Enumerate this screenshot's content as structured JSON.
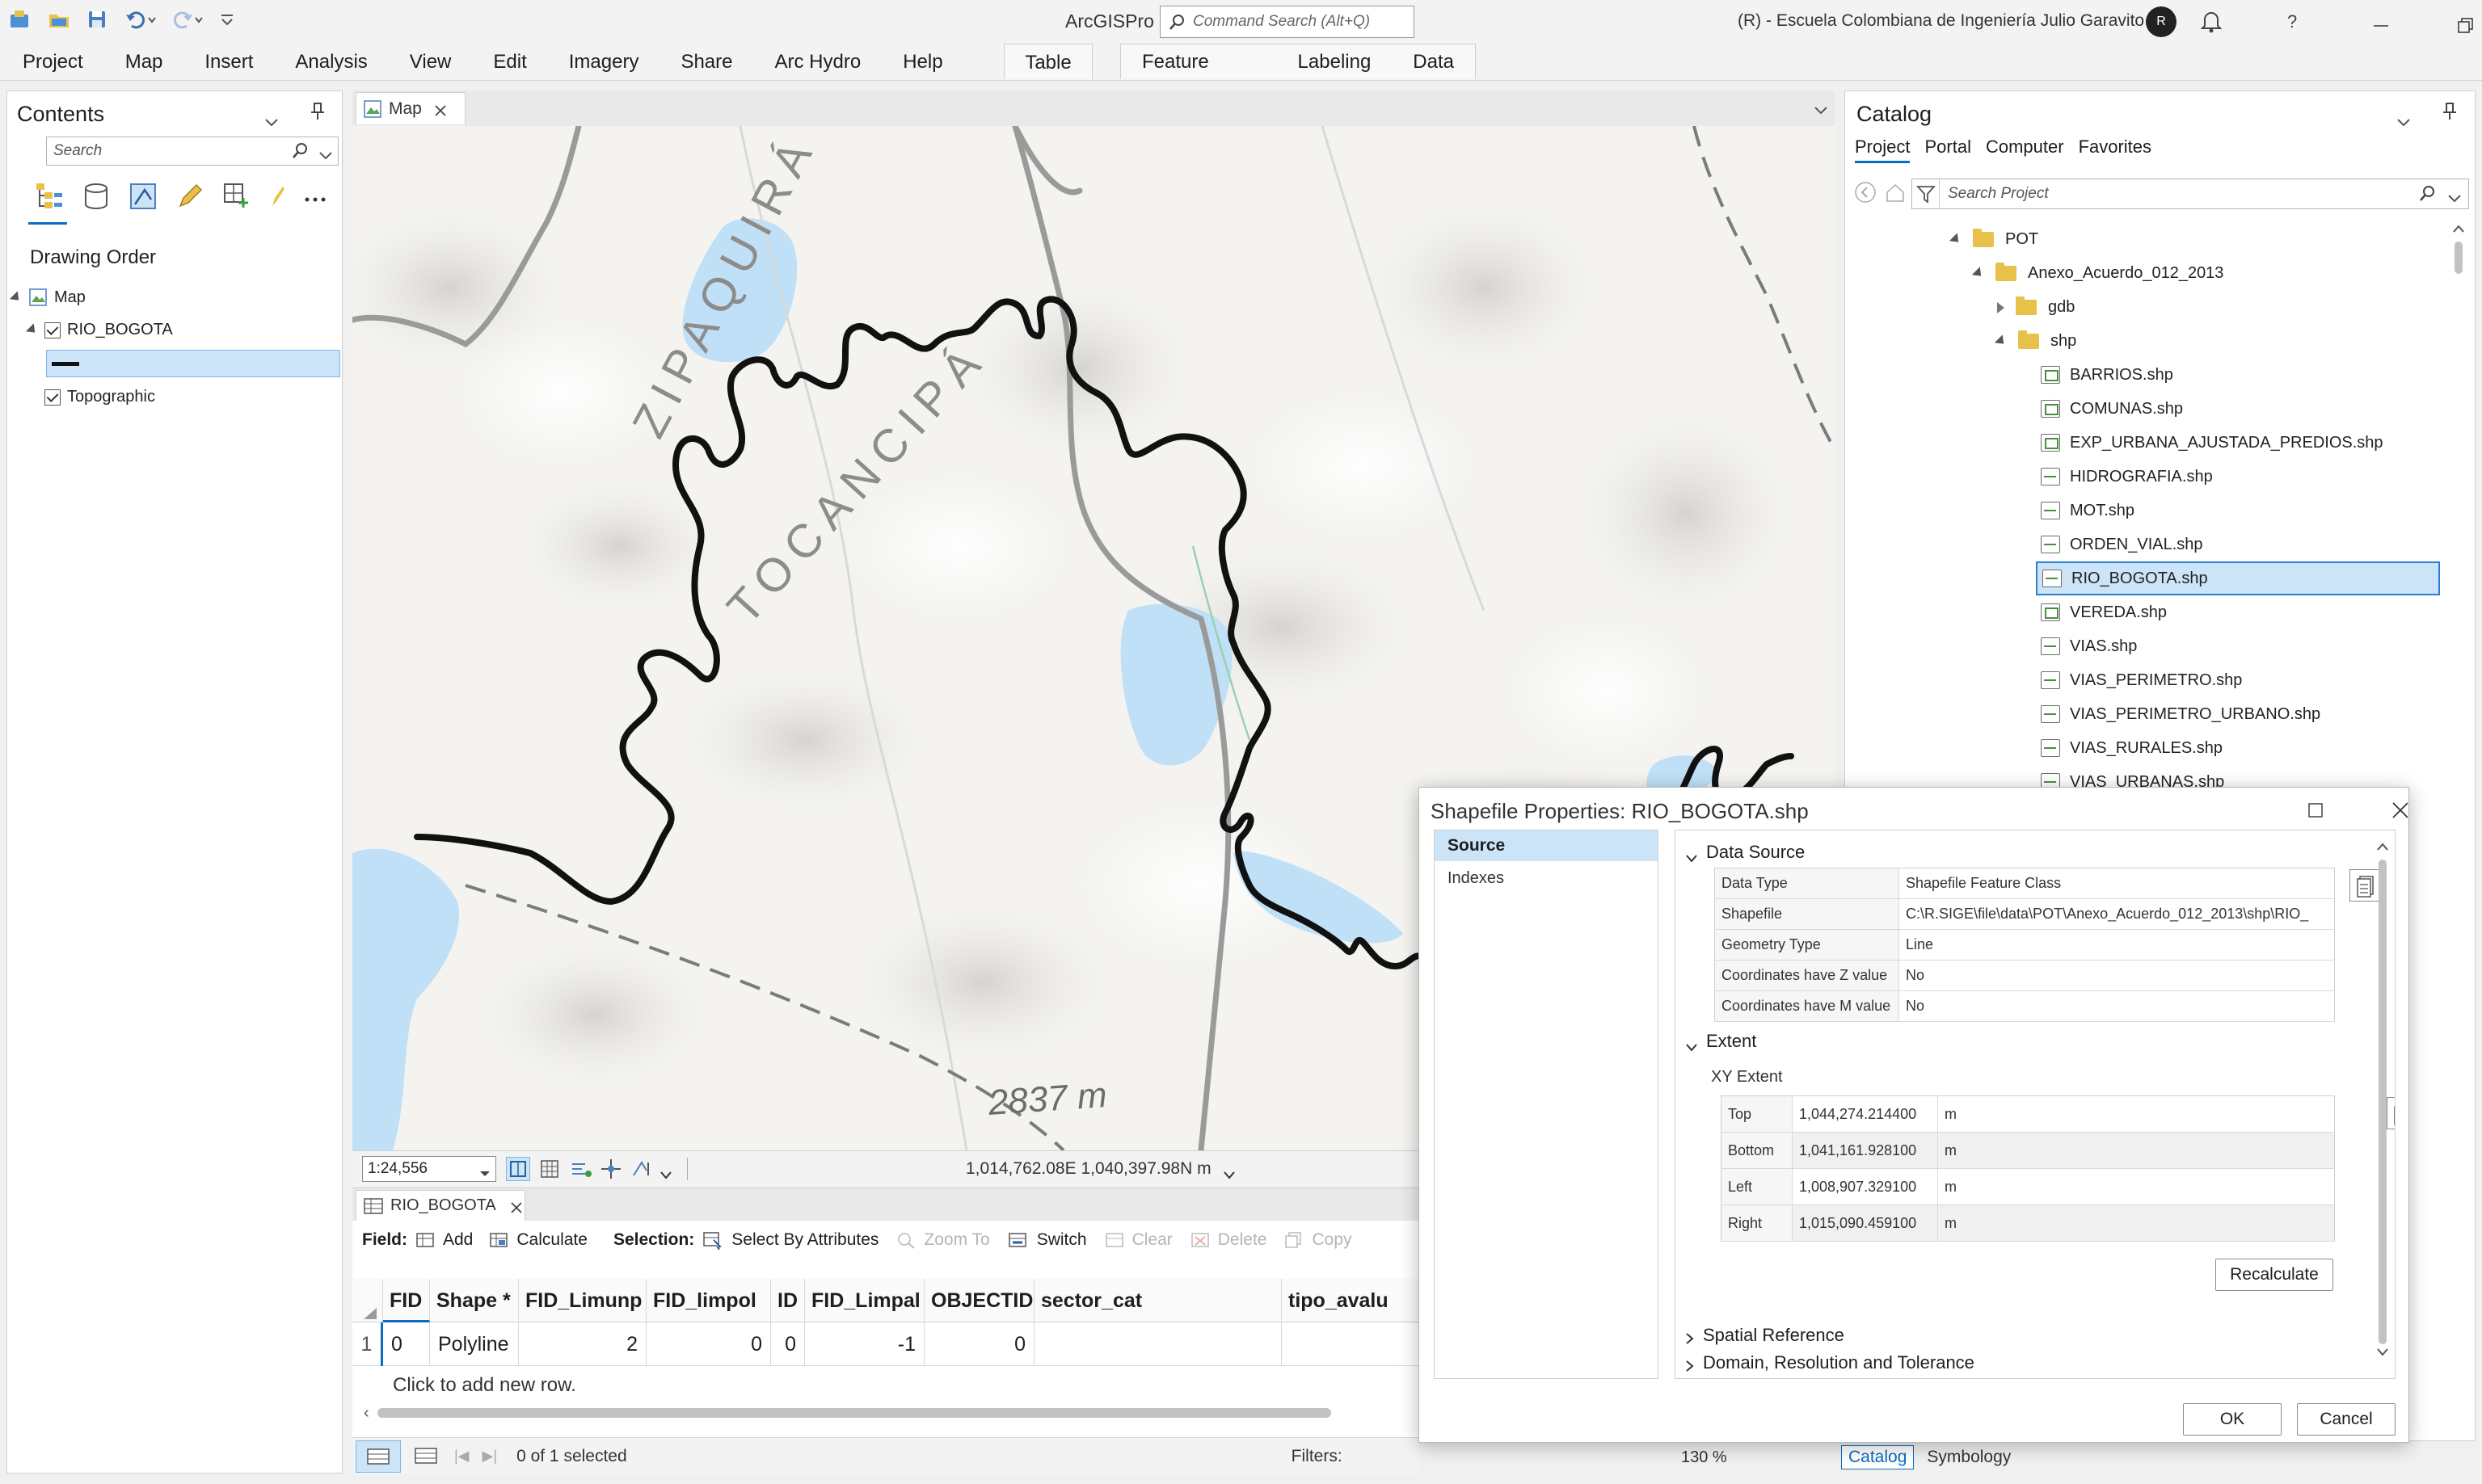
{
  "app": {
    "title": "ArcGISPro",
    "search_placeholder": "Command Search (Alt+Q)",
    "user": "(R) - Escuela Colombiana de Ingeniería Julio Garavito",
    "avatar_initial": "R"
  },
  "menu": [
    "Project",
    "Map",
    "Insert",
    "Analysis",
    "View",
    "Edit",
    "Imagery",
    "Share",
    "Arc Hydro",
    "Help"
  ],
  "context_tabs": {
    "table": "Table",
    "feature_layer": "Feature Layer",
    "labeling": "Labeling",
    "data": "Data"
  },
  "contents": {
    "title": "Contents",
    "search_placeholder": "Search",
    "heading": "Drawing Order",
    "map": "Map",
    "layer": "RIO_BOGOTA",
    "basemap": "Topographic"
  },
  "map_view": {
    "tab": "Map",
    "labels": {
      "zipaquira": "ZIPAQUIRÁ",
      "tocancipa": "TOCANCIPÁ",
      "elevation": "2837 m"
    },
    "scale": "1:24,556",
    "coords": "1,014,762.08E 1,040,397.98N m"
  },
  "attribute_table": {
    "tab": "RIO_BOGOTA",
    "field_label": "Field:",
    "add": "Add",
    "calculate": "Calculate",
    "selection_label": "Selection:",
    "select_by_attributes": "Select By Attributes",
    "zoom_to": "Zoom To",
    "switch": "Switch",
    "clear": "Clear",
    "delete": "Delete",
    "copy": "Copy",
    "columns": [
      "FID",
      "Shape *",
      "FID_Limunp",
      "FID_limpol",
      "ID",
      "FID_Limpal",
      "OBJECTID",
      "sector_cat",
      "tipo_avalu"
    ],
    "row": {
      "num": "1",
      "FID": "0",
      "Shape": "Polyline",
      "FID_Limunp": "2",
      "FID_limpol": "0",
      "ID": "0",
      "FID_Limpal": "-1",
      "OBJECTID": "0",
      "sector_cat": "",
      "tipo_avalu": ""
    },
    "add_row": "Click to add new row.",
    "status": "0 of 1 selected",
    "filters": "Filters:",
    "zoom": "130 %"
  },
  "catalog": {
    "title": "Catalog",
    "tabs": [
      "Project",
      "Portal",
      "Computer",
      "Favorites"
    ],
    "search_placeholder": "Search Project",
    "tree": {
      "pot": "POT",
      "anexo": "Anexo_Acuerdo_012_2013",
      "gdb": "gdb",
      "shp": "shp"
    },
    "files": [
      {
        "name": "BARRIOS.shp",
        "kind": "poly"
      },
      {
        "name": "COMUNAS.shp",
        "kind": "poly"
      },
      {
        "name": "EXP_URBANA_AJUSTADA_PREDIOS.shp",
        "kind": "poly"
      },
      {
        "name": "HIDROGRAFIA.shp",
        "kind": "line"
      },
      {
        "name": "MOT.shp",
        "kind": "line"
      },
      {
        "name": "ORDEN_VIAL.shp",
        "kind": "line"
      },
      {
        "name": "RIO_BOGOTA.shp",
        "kind": "line"
      },
      {
        "name": "VEREDA.shp",
        "kind": "poly"
      },
      {
        "name": "VIAS.shp",
        "kind": "line"
      },
      {
        "name": "VIAS_PERIMETRO.shp",
        "kind": "line"
      },
      {
        "name": "VIAS_PERIMETRO_URBANO.shp",
        "kind": "line"
      },
      {
        "name": "VIAS_RURALES.shp",
        "kind": "line"
      },
      {
        "name": "VIAS_URBANAS.shp",
        "kind": "line"
      }
    ],
    "bottom_tabs": [
      "Catalog",
      "Symbology"
    ]
  },
  "dialog": {
    "title": "Shapefile Properties: RIO_BOGOTA.shp",
    "nav": [
      "Source",
      "Indexes"
    ],
    "data_source_heading": "Data Source",
    "data_source": [
      {
        "k": "Data Type",
        "v": "Shapefile Feature Class"
      },
      {
        "k": "Shapefile",
        "v": "C:\\R.SIGE\\file\\data\\POT\\Anexo_Acuerdo_012_2013\\shp\\RIO_"
      },
      {
        "k": "Geometry Type",
        "v": "Line"
      },
      {
        "k": "Coordinates have Z value",
        "v": "No"
      },
      {
        "k": "Coordinates have M value",
        "v": "No"
      }
    ],
    "extent_heading": "Extent",
    "xy_extent_label": "XY Extent",
    "extent": [
      {
        "k": "Top",
        "v": "1,044,274.214400",
        "u": "m"
      },
      {
        "k": "Bottom",
        "v": "1,041,161.928100",
        "u": "m"
      },
      {
        "k": "Left",
        "v": "1,008,907.329100",
        "u": "m"
      },
      {
        "k": "Right",
        "v": "1,015,090.459100",
        "u": "m"
      }
    ],
    "recalculate": "Recalculate",
    "spatial_reference": "Spatial Reference",
    "domain": "Domain, Resolution and Tolerance",
    "ok": "OK",
    "cancel": "Cancel"
  },
  "colors": {
    "accent": "#0a6cc2",
    "selection": "#cce4f7",
    "water": "#bfe0f7",
    "river": "#111111"
  }
}
